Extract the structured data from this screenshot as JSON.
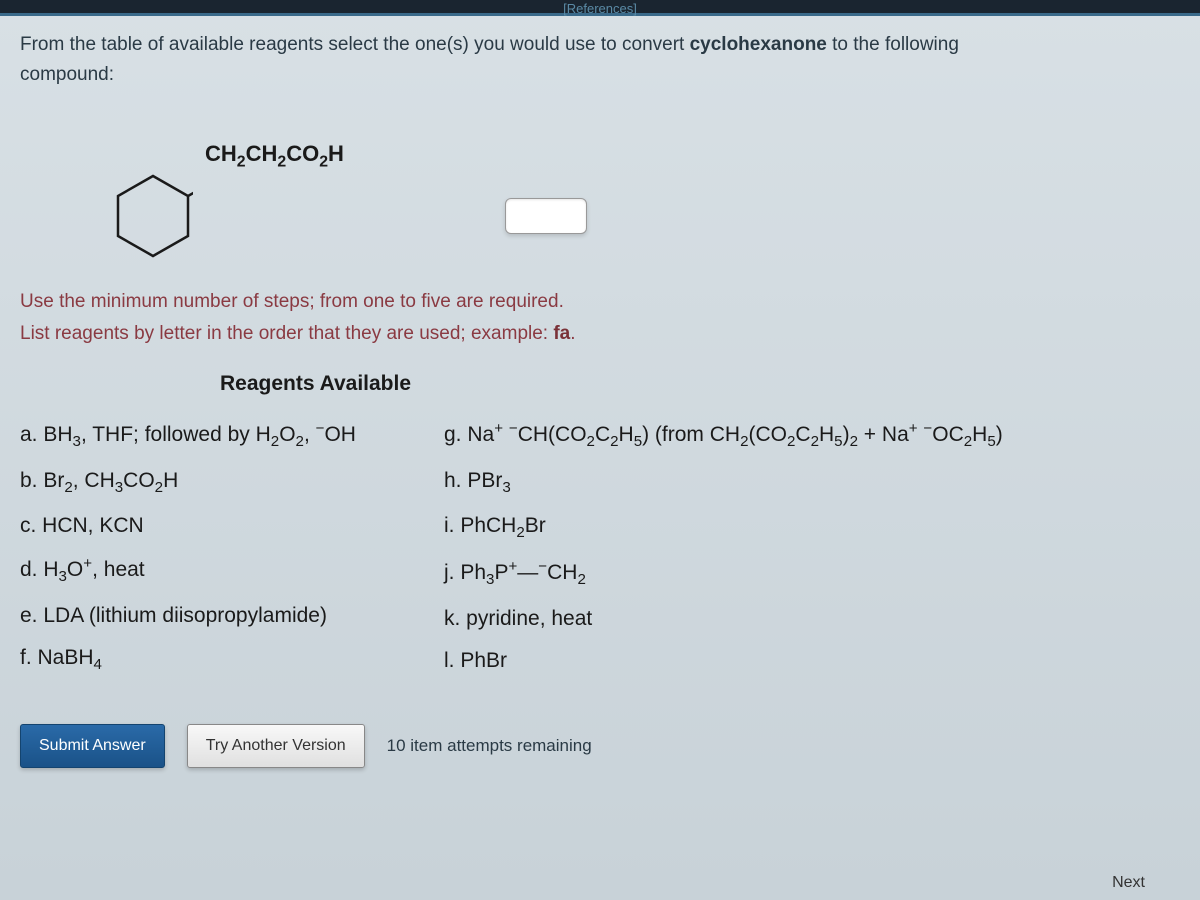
{
  "header": {
    "references_link": "[References]"
  },
  "question": {
    "line1_prefix": "From the table of available reagents select the one(s) you would use to convert ",
    "line1_bold": "cyclohexanone",
    "line1_suffix": " to the following",
    "line2": "compound:"
  },
  "substituent_label": "CH₂CH₂CO₂H",
  "instructions": {
    "line1": "Use the minimum number of steps; from one to five are required.",
    "line2_prefix": "List reagents by letter in the order that they are used; example: ",
    "line2_example": "fa",
    "line2_suffix": "."
  },
  "reagents_title": "Reagents Available",
  "reagents_left": [
    "a. BH₃, THF; followed by H₂O₂, ⁻OH",
    "b. Br₂, CH₃CO₂H",
    "c. HCN, KCN",
    "d. H₃O⁺, heat",
    "e. LDA (lithium diisopropylamide)",
    "f. NaBH₄"
  ],
  "reagents_right": [
    "g. Na⁺ ⁻CH(CO₂C₂H₅) (from CH₂(CO₂C₂H₅)₂ + Na⁺ ⁻OC₂H₅)",
    "h. PBr₃",
    "i. PhCH₂Br",
    "j. Ph₃P⁺—⁻CH₂",
    "k. pyridine, heat",
    "l. PhBr"
  ],
  "buttons": {
    "submit": "Submit Answer",
    "try_another": "Try Another Version"
  },
  "attempts_text": "10 item attempts remaining",
  "footer": {
    "next": "Next"
  }
}
